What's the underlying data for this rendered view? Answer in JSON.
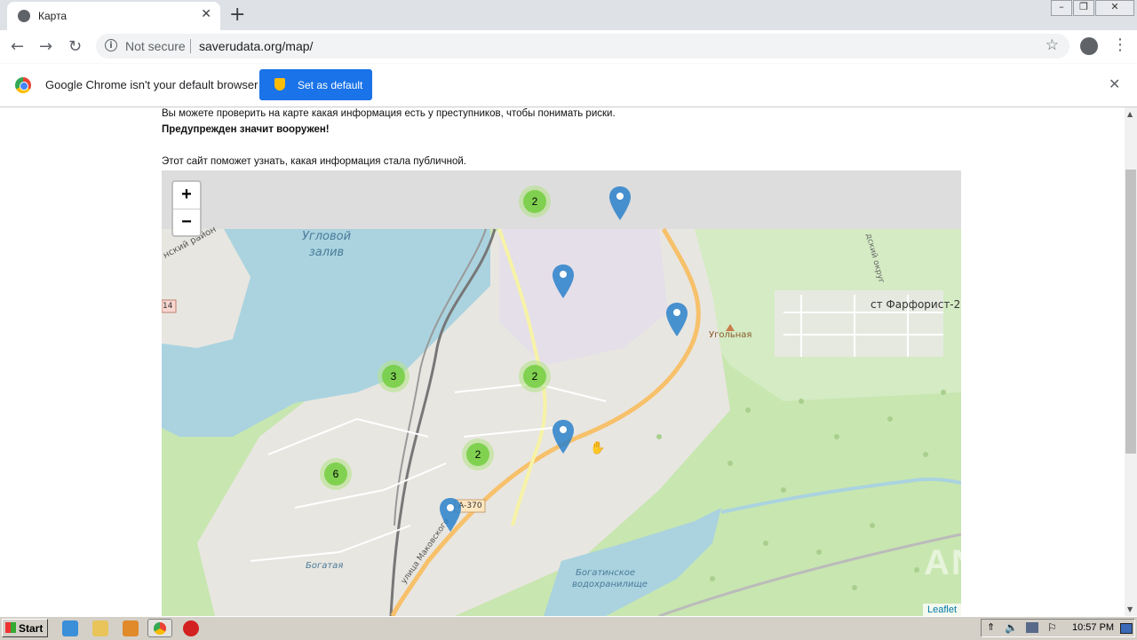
{
  "browser": {
    "tab_title": "Карта",
    "new_tab": "+",
    "tab_close": "✕",
    "security_label": "Not secure",
    "url": "saverudata.org/map/",
    "window_controls": [
      "–",
      "❐",
      "✕"
    ]
  },
  "infobar": {
    "message": "Google Chrome isn't your default browser",
    "button_label": "Set as default",
    "close": "✕"
  },
  "page": {
    "line1": "Вы можете проверить на карте какая информация есть у преступников, чтобы понимать риски.",
    "line2": "Предупрежден значит вооружен!",
    "line3": "Этот сайт поможет узнать, какая информация стала публичной."
  },
  "map": {
    "zoom_in": "+",
    "zoom_out": "−",
    "attribution": "Leaflet",
    "labels": {
      "bay": "Угловой залив",
      "bay_line1": "Угловой",
      "bay_line2": "залив",
      "district": "нский район",
      "road_num": "14",
      "settlement": "ст Фарфорист-2",
      "ugolnaya": "Угольная",
      "road": "А-370",
      "street": "улица Маковского",
      "reservoir1": "Богатинское",
      "reservoir2": "водохранилище",
      "river": "Богатая",
      "district2": "дский округ"
    },
    "clusters": [
      "2",
      "3",
      "2",
      "2",
      "6"
    ],
    "colors": {
      "water": "#aad3df",
      "forest": "#c8e6b0",
      "urban": "#e8e6e1",
      "marker": "#2a81cb",
      "road": "#f7c16b"
    }
  },
  "taskbar": {
    "start": "Start",
    "clock": "10:57 PM"
  },
  "watermark": "ANY RUN"
}
